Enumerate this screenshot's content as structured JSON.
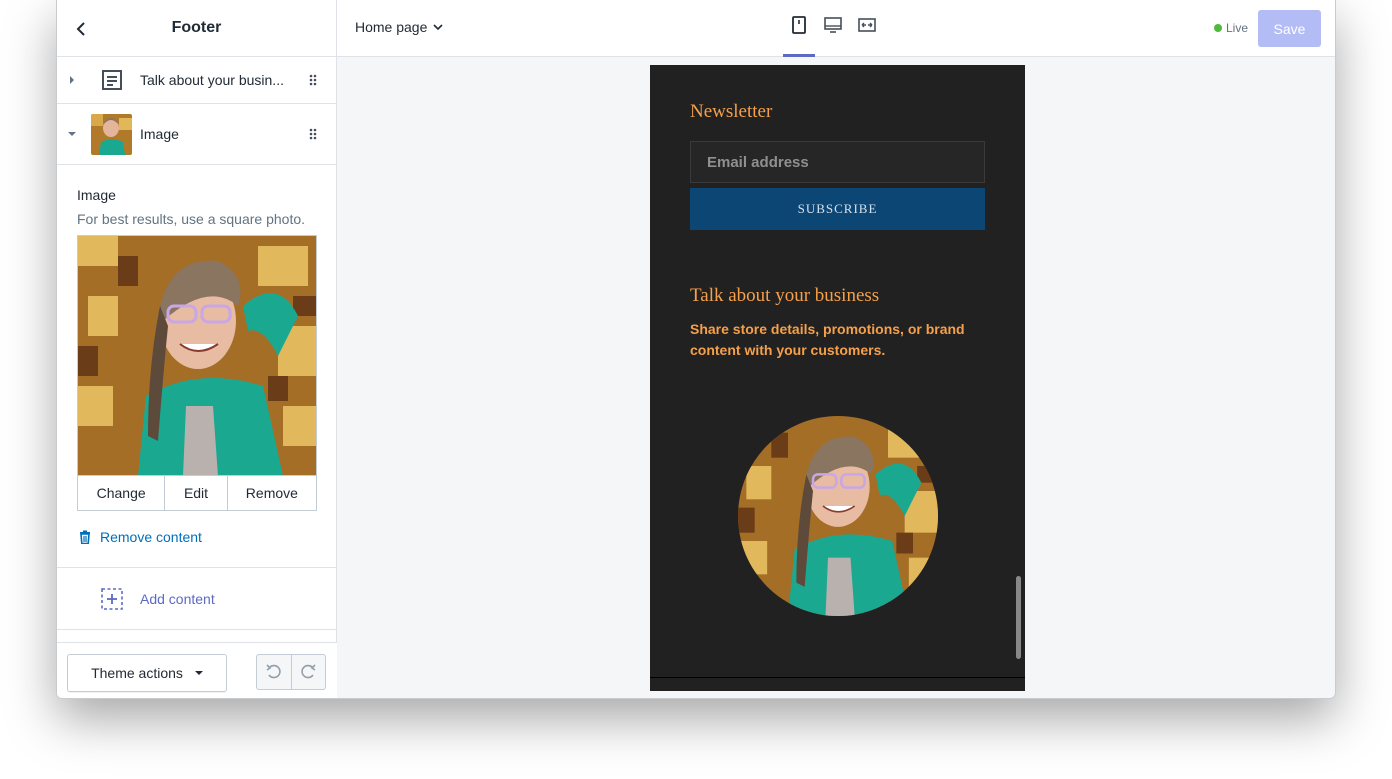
{
  "sidebar": {
    "title": "Footer",
    "blocks": [
      {
        "label": "Talk about your busin...",
        "icon": "text-block-icon"
      },
      {
        "label": "Image",
        "icon": "image-thumbnail"
      }
    ],
    "image_setting": {
      "label": "Image",
      "help": "For best results, use a square photo.",
      "change_label": "Change",
      "edit_label": "Edit",
      "remove_label": "Remove"
    },
    "remove_content_label": "Remove content",
    "add_content_label": "Add content",
    "theme_actions_label": "Theme actions"
  },
  "topbar": {
    "page_select": "Home page",
    "devices": [
      "mobile-icon",
      "desktop-icon",
      "fullscreen-icon"
    ],
    "active_device": "mobile",
    "live_label": "Live",
    "save_label": "Save"
  },
  "preview": {
    "newsletter_heading": "Newsletter",
    "email_placeholder": "Email address",
    "subscribe_label": "SUBSCRIBE",
    "business_heading": "Talk about your business",
    "business_text": "Share store details, promotions, or brand content with your customers."
  },
  "colors": {
    "accent": "#5c6ac4",
    "link": "#006fbb",
    "preview_bg": "#212121",
    "preview_text": "#f5a04a",
    "subscribe_bg": "#0c4675",
    "live_dot": "#50b83c",
    "save_disabled": "#b3bcf5"
  }
}
